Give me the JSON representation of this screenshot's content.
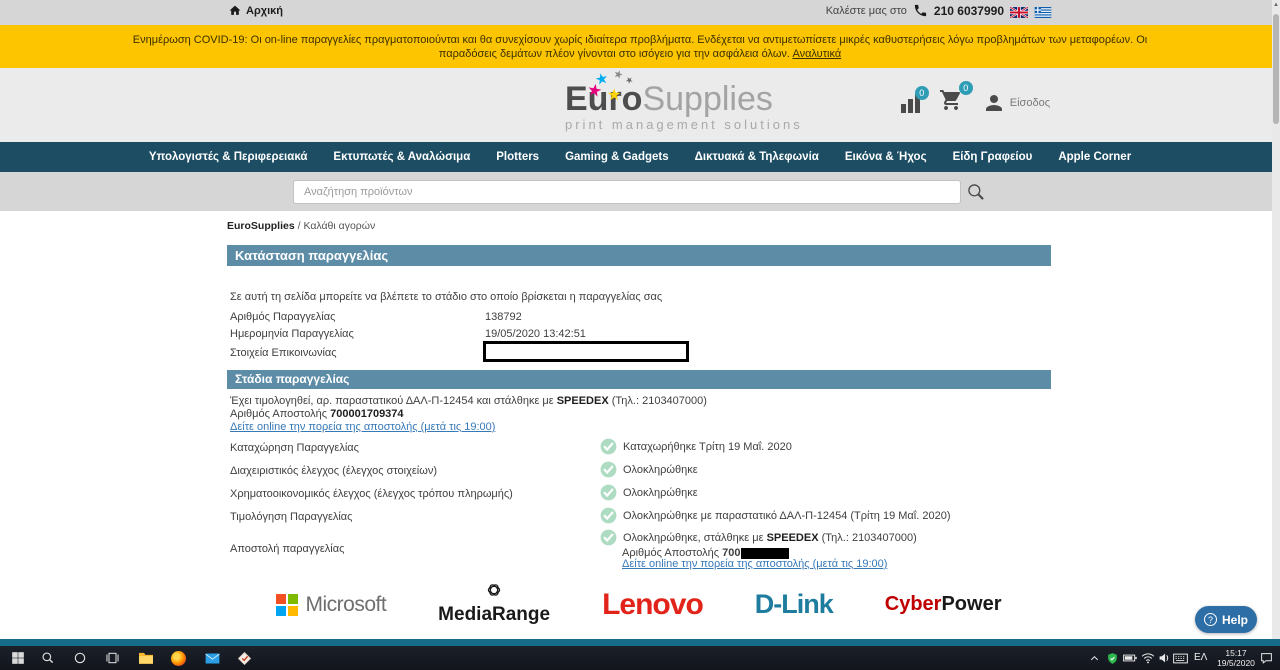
{
  "topbar": {
    "home_label": "Αρχική",
    "call_prefix": "Καλέστε μας στο",
    "phone": "210 6037990"
  },
  "banner": {
    "text": "Ενημέρωση COVID-19: Οι on-line παραγγελίες πραγματοποιούνται και θα συνεχίσουν χωρίς ιδιαίτερα προβλήματα. Ενδέχεται να αντιμετωπίσετε μικρές καθυστερήσεις λόγω προβλημάτων των μεταφορέων. Οι παραδόσεις δεμάτων πλέον γίνονται στο ισόγειο για την ασφάλεια όλων.",
    "link": "Αναλυτικά"
  },
  "logo": {
    "euro": "Euro",
    "supplies": "Supplies",
    "tagline": "print management solutions"
  },
  "header": {
    "compare_badge": "0",
    "cart_badge": "0",
    "login_label": "Είσοδος"
  },
  "nav": {
    "items": [
      "Υπολογιστές & Περιφερειακά",
      "Εκτυπωτές & Αναλώσιμα",
      "Plotters",
      "Gaming & Gadgets",
      "Δικτυακά & Τηλεφωνία",
      "Εικόνα & Ήχος",
      "Είδη Γραφείου",
      "Apple Corner"
    ]
  },
  "search": {
    "placeholder": "Αναζήτηση προϊόντων"
  },
  "breadcrumb": {
    "root": "EuroSupplies",
    "separator": " / ",
    "current": "Καλάθι αγορών"
  },
  "order": {
    "title": "Κατάσταση παραγγελίας",
    "intro": "Σε αυτή τη σελίδα μπορείτε να βλέπετε το στάδιο στο οποίο βρίσκεται η παραγγελίας σας",
    "fields": [
      {
        "label": "Αριθμός Παραγγελίας",
        "value": "138792"
      },
      {
        "label": "Ημερομηνία Παραγγελίας",
        "value": "19/05/2020 13:42:51"
      },
      {
        "label": "Στοιχεία Επικοινωνίας",
        "value": ""
      }
    ]
  },
  "stages": {
    "title": "Στάδια παραγγελίας",
    "invoice_pre": "Έχει τιμολογηθεί, αρ. παραστατικού ΔΑΛ-Π-12454 και στάλθηκε με ",
    "carrier": "SPEEDEX",
    "invoice_post": " (Τηλ.: 2103407000)",
    "tracking_label": "Αριθμός Αποστολής ",
    "tracking_number": "700001709374",
    "tracking_link": "Δείτε online την πορεία της αποστολής (μετά τις 19:00)",
    "rows": [
      {
        "label": "Καταχώρηση Παραγγελίας",
        "status": "Καταχωρήθηκε Τρίτη 19 Μαΐ. 2020"
      },
      {
        "label": "Διαχειριστικός έλεγχος (έλεγχος στοιχείων)",
        "status": "Ολοκληρώθηκε"
      },
      {
        "label": "Χρηματοοικονομικός έλεγχος (έλεγχος τρόπου πληρωμής)",
        "status": "Ολοκληρώθηκε"
      },
      {
        "label": "Τιμολόγηση Παραγγελίας",
        "status": "Ολοκληρώθηκε με παραστατικό ΔΑΛ-Π-12454 (Τρίτη 19 Μαΐ. 2020)"
      }
    ],
    "ship_row": {
      "label": "Αποστολή παραγγελίας",
      "status_pre": "Ολοκληρώθηκε, στάλθηκε με ",
      "carrier": "SPEEDEX",
      "status_post": " (Τηλ.: 2103407000)",
      "ship_label": "Αριθμός Αποστολής ",
      "ship_prefix": "700",
      "link": "Δείτε online την πορεία της αποστολής (μετά τις 19:00)"
    }
  },
  "brands": {
    "microsoft": "Microsoft",
    "mediarange": "MediaRange",
    "lenovo": "Lenovo",
    "dlink": "D-Link",
    "cyber": "Cyber",
    "power": "Power"
  },
  "help": {
    "label": "Help"
  },
  "taskbar": {
    "language": "ΕΛ",
    "time": "15:17",
    "date": "19/5/2020",
    "left_icons": [
      "start-icon",
      "search-icon",
      "cortana-icon",
      "task-view-icon",
      "file-explorer-icon",
      "firefox-icon",
      "mail-icon",
      "todo-icon"
    ],
    "tray_icons": [
      "chevron-up-icon",
      "defender-shield-icon",
      "battery-icon",
      "wifi-icon",
      "volume-icon",
      "keyboard-icon",
      "notification-icon"
    ]
  },
  "colors": {
    "banner_yellow": "#fdc500",
    "navbar_teal": "#1c4d63",
    "section_header_blue": "#5d8ca7",
    "badge_teal": "#2f9db6",
    "check_green": "#aedcc3",
    "link_blue": "#3778b7",
    "help_blue": "#2e6ea6",
    "lenovo_red": "#e2231a",
    "dlink_teal": "#1e7d9e",
    "cyberpower_red": "#c00000"
  }
}
